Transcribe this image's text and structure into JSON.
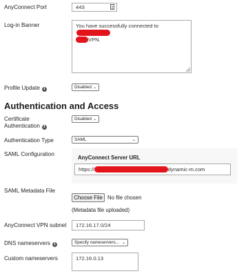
{
  "form": {
    "anyconnect_port": {
      "label": "AnyConnect Port",
      "value": "443"
    },
    "login_banner": {
      "label": "Log-in Banner",
      "text_before": "You have successfully connected to",
      "text_after": "VPN."
    },
    "profile_update": {
      "label": "Profile Update",
      "value": "Disabled"
    }
  },
  "section": {
    "heading": "Authentication and Access"
  },
  "auth": {
    "cert_auth": {
      "label_line1": "Certificate",
      "label_line2": "Authentication",
      "value": "Disabled"
    },
    "auth_type": {
      "label": "Authentication Type",
      "value": "SAML"
    },
    "saml_config": {
      "label": "SAML Configuration",
      "server_url_title": "AnyConnect Server URL",
      "url_prefix": "https://",
      "url_suffix": "dynamic-m.com"
    },
    "saml_metadata": {
      "label": "SAML Metadata File",
      "button": "Choose File",
      "status": "No file chosen",
      "note": "(Metadata file uploaded)"
    },
    "vpn_subnet": {
      "label": "AnyConnect VPN subnet",
      "value": "172.16.17.0/24"
    },
    "dns_nameservers": {
      "label": "DNS nameservers",
      "value": "Specify nameservers..."
    },
    "custom_nameservers": {
      "label": "Custom nameservers",
      "value": "172.16.0.13"
    }
  },
  "icons": {
    "info": "info-icon",
    "stepper": "number-stepper-icon",
    "dropdown": "chevron-down-icon"
  },
  "colors": {
    "redaction": "#e3141b"
  }
}
